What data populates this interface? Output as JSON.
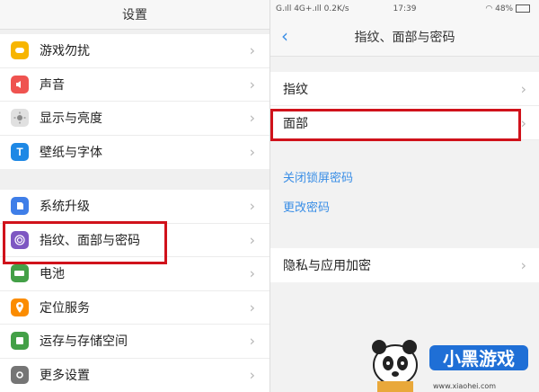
{
  "left": {
    "title": "设置",
    "group1": [
      {
        "label": "游戏勿扰",
        "icon": "gamepad-icon",
        "color": "#f7b500"
      },
      {
        "label": "声音",
        "icon": "speaker-icon",
        "color": "#ef5350"
      },
      {
        "label": "显示与亮度",
        "icon": "brightness-icon",
        "color": "#9e9e9e"
      },
      {
        "label": "壁纸与字体",
        "icon": "font-icon",
        "color": "#1e88e5"
      }
    ],
    "group2": [
      {
        "label": "系统升级",
        "icon": "update-icon",
        "color": "#3f7ee8"
      },
      {
        "label": "指纹、面部与密码",
        "icon": "fingerprint-icon",
        "color": "#7e57c2"
      },
      {
        "label": "电池",
        "icon": "battery-icon",
        "color": "#43a047"
      },
      {
        "label": "定位服务",
        "icon": "location-icon",
        "color": "#fb8c00"
      },
      {
        "label": "运存与存储空间",
        "icon": "storage-icon",
        "color": "#43a047"
      },
      {
        "label": "更多设置",
        "icon": "settings-icon",
        "color": "#757575"
      }
    ]
  },
  "right": {
    "status": {
      "left": "G.ıll 4G+.ıll 0.2K/s",
      "time": "17:39",
      "right": "48%"
    },
    "title": "指纹、面部与密码",
    "items": [
      {
        "label": "指纹"
      },
      {
        "label": "面部"
      }
    ],
    "links": [
      "关闭锁屏密码",
      "更改密码"
    ],
    "privacy": "隐私与应用加密"
  },
  "watermark": {
    "brand": "小黑游戏",
    "url": "www.xiaohei.com"
  },
  "colors": {
    "highlight": "#d0121b",
    "link": "#3a8ee6"
  }
}
